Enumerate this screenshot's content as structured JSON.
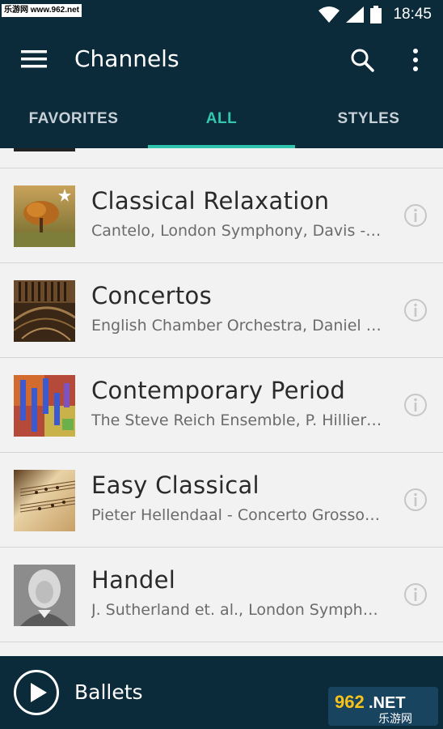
{
  "status_bar": {
    "watermark": "乐游网 www.962.net",
    "time": "18:45"
  },
  "app_bar": {
    "title": "Channels",
    "icons": [
      "menu-icon",
      "search-icon",
      "more-vert-icon"
    ]
  },
  "tabs": [
    {
      "label": "FAVORITES",
      "active": false
    },
    {
      "label": "ALL",
      "active": true
    },
    {
      "label": "STYLES",
      "active": false
    }
  ],
  "accent_color": "#2ec4ad",
  "channels": [
    {
      "title": "Classical Relaxation",
      "subtitle": "Cantelo, London Symphony, Davis - Mozart: Symphony",
      "favorite": true
    },
    {
      "title": "Concertos",
      "subtitle": "English Chamber Orchestra, Daniel Barenboim",
      "favorite": false
    },
    {
      "title": "Contemporary Period",
      "subtitle": "The Steve Reich Ensemble, P. Hillier, Reich",
      "favorite": false
    },
    {
      "title": "Easy Classical",
      "subtitle": "Pieter Hellendaal - Concerto Grosso in G",
      "favorite": false
    },
    {
      "title": "Handel",
      "subtitle": "J. Sutherland et. al., London Symphony Orchestra",
      "favorite": false
    }
  ],
  "player": {
    "now_playing": "Ballets"
  },
  "watermark_bottom": {
    "number": "962",
    "suffix": ".NET",
    "chinese": "乐游网"
  }
}
